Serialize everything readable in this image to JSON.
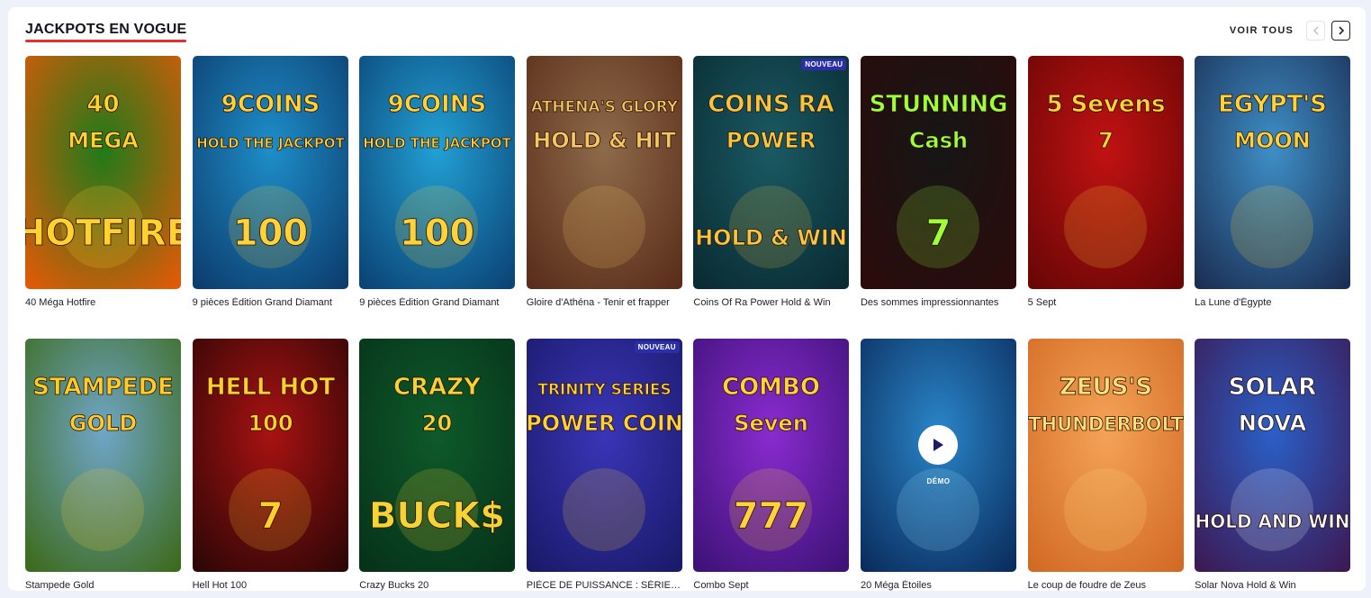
{
  "section": {
    "title": "JACKPOTS EN VOGUE",
    "see_all": "VOIR TOUS"
  },
  "games": [
    {
      "name": "40 Méga Hotfire",
      "art": [
        "40",
        "MEGA",
        "HOTFIRE"
      ],
      "bg": [
        "#1f7a1a",
        "#e05a08"
      ],
      "accent": "#ffd230"
    },
    {
      "name": "9 pièces Édition Grand Diamant",
      "art": [
        "9COINS",
        "HOLD THE JACKPOT",
        "100"
      ],
      "bg": [
        "#1e8ec9",
        "#0c3d6e"
      ],
      "accent": "#ffd23a"
    },
    {
      "name": "9 pièces Édition Grand Diamant",
      "art": [
        "9COINS",
        "HOLD THE JACKPOT",
        "100"
      ],
      "bg": [
        "#22a0d4",
        "#0b4476"
      ],
      "accent": "#ffd23a"
    },
    {
      "name": "Gloire d'Athéna - Tenir et frapper",
      "art": [
        "ATHENA'S GLORY",
        "HOLD & HIT",
        ""
      ],
      "bg": [
        "#8e6a4a",
        "#5a2e1a"
      ],
      "accent": "#f2c764"
    },
    {
      "name": "Coins Of Ra Power Hold & Win",
      "art": [
        "COINS RA",
        "POWER",
        "HOLD & WIN"
      ],
      "bg": [
        "#1a5a63",
        "#0a2b33"
      ],
      "accent": "#f5c441",
      "badge": "NOUVEAU"
    },
    {
      "name": "Des sommes impressionnantes",
      "art": [
        "STUNNING",
        "Cash",
        "7"
      ],
      "bg": [
        "#161616",
        "#2c0b0b"
      ],
      "accent": "#9cff3a"
    },
    {
      "name": "5 Sept",
      "art": [
        "5 Sevens",
        "7",
        ""
      ],
      "bg": [
        "#c11212",
        "#6a0606"
      ],
      "accent": "#ffd23a"
    },
    {
      "name": "La Lune d'Égypte",
      "art": [
        "EGYPT'S",
        "MOON",
        ""
      ],
      "bg": [
        "#3e8fc7",
        "#1b2f55"
      ],
      "accent": "#ffd23a"
    },
    {
      "name": "Stampede Gold",
      "art": [
        "STAMPEDE",
        "GOLD",
        ""
      ],
      "bg": [
        "#6fa6c8",
        "#3d6b1d"
      ],
      "accent": "#ffcc2a"
    },
    {
      "name": "Hell Hot 100",
      "art": [
        "HELL HOT",
        "100",
        "7"
      ],
      "bg": [
        "#a91212",
        "#2e0606"
      ],
      "accent": "#ffcd2c"
    },
    {
      "name": "Crazy Bucks 20",
      "art": [
        "CRAZY",
        "20",
        "BUCK$"
      ],
      "bg": [
        "#0e5a2a",
        "#06321a"
      ],
      "accent": "#f5d334"
    },
    {
      "name": "PIÈCE DE PUISSANCE : SÉRIE TRIN...",
      "art": [
        "TRINITY SERIES",
        "POWER COIN",
        ""
      ],
      "bg": [
        "#3a35b8",
        "#1a1a6a"
      ],
      "accent": "#ffd23a",
      "badge": "NOUVEAU"
    },
    {
      "name": "Combo Sept",
      "art": [
        "COMBO",
        "Seven",
        "777"
      ],
      "bg": [
        "#8a2bd0",
        "#3e1278"
      ],
      "accent": "#ffd23a"
    },
    {
      "name": "20 Méga Étoiles",
      "art": [
        "",
        "",
        ""
      ],
      "bg": [
        "#2a85c8",
        "#0a2d5e"
      ],
      "accent": "#9fe3ff",
      "demo": "DÉMO"
    },
    {
      "name": "Le coup de foudre de Zeus",
      "art": [
        "ZEUS'S",
        "THUNDERBOLT",
        ""
      ],
      "bg": [
        "#f4a358",
        "#d36a24"
      ],
      "accent": "#ffe07a"
    },
    {
      "name": "Solar Nova Hold & Win",
      "art": [
        "SOLAR",
        "NOVA",
        "HOLD AND WIN"
      ],
      "bg": [
        "#2a60c8",
        "#3c1a55"
      ],
      "accent": "#ffffff"
    }
  ]
}
